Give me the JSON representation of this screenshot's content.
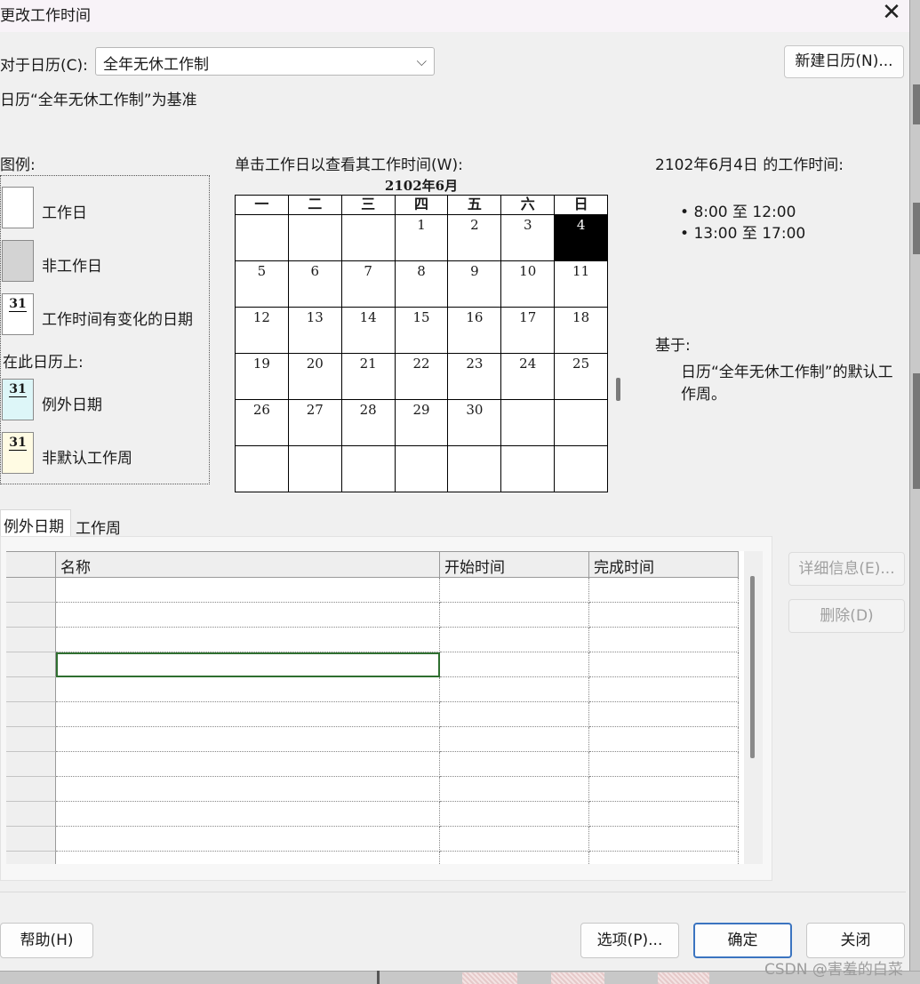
{
  "dialog": {
    "title": "更改工作时间",
    "close_glyph": "✕"
  },
  "calendar_selector": {
    "label": "对于日历(C):",
    "value": "全年无休工作制",
    "chevron": "⌵",
    "new_calendar_button": "新建日历(N)...",
    "base_note": "日历“全年无休工作制”为基准"
  },
  "legend": {
    "title": "图例:",
    "items": [
      {
        "label": "工作日",
        "swatch_text": "",
        "color": "#ffffff"
      },
      {
        "label": "非工作日",
        "swatch_text": "",
        "color": "#d3d3d3"
      },
      {
        "label": "工作时间有变化的日期",
        "swatch_text": "31",
        "color": "#ffffff"
      }
    ],
    "on_calendar_label": "在此日历上:",
    "calendar_items": [
      {
        "label": "例外日期",
        "swatch_text": "31",
        "color": "#ddf6f8"
      },
      {
        "label": "非默认工作周",
        "swatch_text": "31",
        "color": "#fffbe3"
      }
    ]
  },
  "calendar": {
    "instruction": "单击工作日以查看其工作时间(W):",
    "month_title": "2102年6月",
    "weekdays": [
      "一",
      "二",
      "三",
      "四",
      "五",
      "六",
      "日"
    ],
    "weeks": [
      [
        "",
        "",
        "",
        "1",
        "2",
        "3",
        "4"
      ],
      [
        "5",
        "6",
        "7",
        "8",
        "9",
        "10",
        "11"
      ],
      [
        "12",
        "13",
        "14",
        "15",
        "16",
        "17",
        "18"
      ],
      [
        "19",
        "20",
        "21",
        "22",
        "23",
        "24",
        "25"
      ],
      [
        "26",
        "27",
        "28",
        "29",
        "30",
        "",
        ""
      ],
      [
        "",
        "",
        "",
        "",
        "",
        "",
        ""
      ]
    ],
    "selected_day": "4"
  },
  "working_time": {
    "title": "2102年6月4日 的工作时间:",
    "slots": [
      "8:00 至 12:00",
      "13:00 至 17:00"
    ],
    "based_on_label": "基于:",
    "based_on_line1": "日历“全年无休工作制”的默认工",
    "based_on_line2": "作周。"
  },
  "tabs": [
    {
      "label": "例外日期",
      "active": true
    },
    {
      "label": "工作周",
      "active": false
    }
  ],
  "exceptions_table": {
    "columns": [
      "名称",
      "开始时间",
      "完成时间"
    ],
    "row_count": 12,
    "rows": []
  },
  "side_buttons": {
    "details": "详细信息(E)...",
    "delete": "删除(D)"
  },
  "footer": {
    "help": "帮助(H)",
    "options": "选项(P)...",
    "ok": "确定",
    "close": "关闭"
  },
  "watermark": "CSDN @害羞的白菜"
}
